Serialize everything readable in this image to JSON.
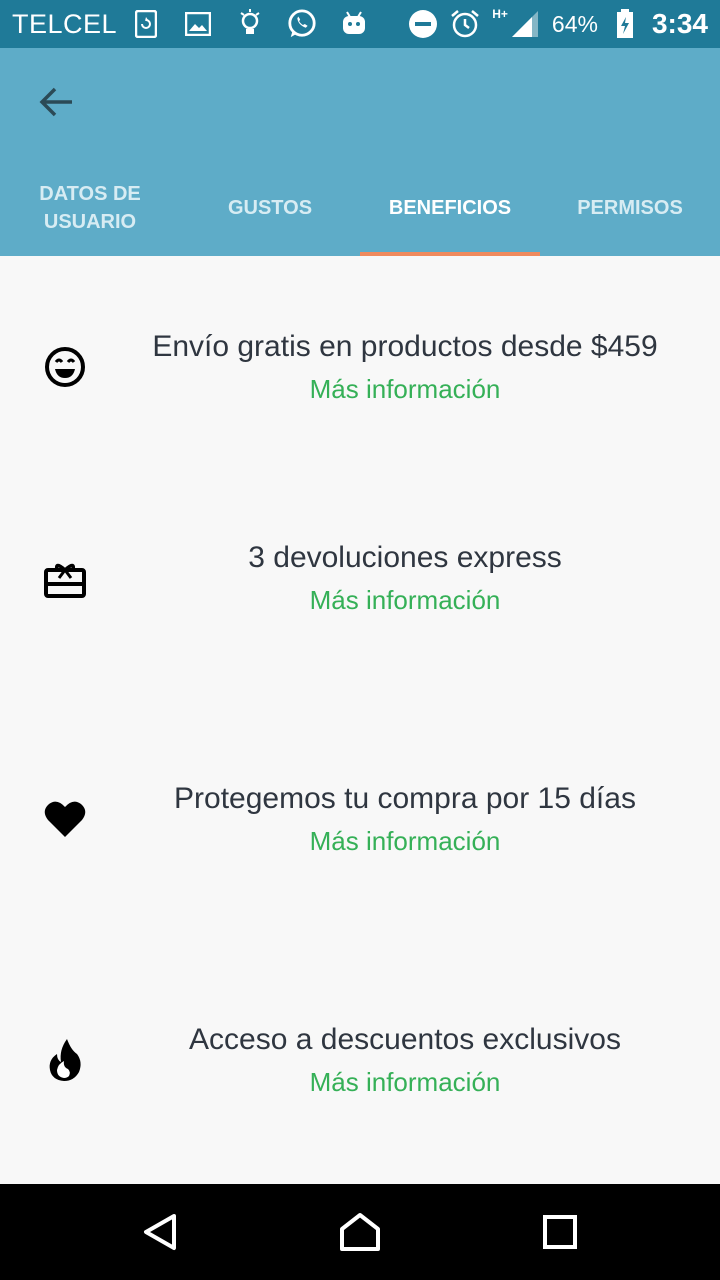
{
  "status_bar": {
    "carrier": "TELCEL",
    "network": "H+",
    "battery": "64%",
    "time": "3:34",
    "left_icons": [
      "sync-icon",
      "image-icon",
      "lightbulb-icon",
      "whatsapp-icon",
      "android-icon"
    ],
    "right_icons": [
      "do-not-disturb-icon",
      "alarm-icon",
      "signal-icon",
      "battery-icon"
    ]
  },
  "app_bar": {
    "back_icon": "arrow-back-icon",
    "tabs": [
      {
        "label": "DATOS DE USUARIO"
      },
      {
        "label": "GUSTOS"
      },
      {
        "label": "BENEFICIOS"
      },
      {
        "label": "PERMISOS"
      }
    ],
    "active_tab": "BENEFICIOS",
    "colors": {
      "app_bar": "#5eacc8",
      "status_bar": "#1f7a98",
      "indicator": "#f08a5d"
    }
  },
  "benefits": [
    {
      "icon": "smiley-icon",
      "title": "Envío gratis en productos desde $459",
      "link": "Más información"
    },
    {
      "icon": "gift-card-icon",
      "title": "3 devoluciones express",
      "link": "Más información"
    },
    {
      "icon": "heart-icon",
      "title": "Protegemos tu compra por 15 días",
      "link": "Más información"
    },
    {
      "icon": "flame-icon",
      "title": "Acceso a descuentos exclusivos",
      "link": "Más información"
    }
  ],
  "colors": {
    "link": "#35b057",
    "text": "#2f3640"
  },
  "nav_bar": {
    "icons": [
      "back-triangle-icon",
      "home-icon",
      "recents-square-icon"
    ]
  }
}
